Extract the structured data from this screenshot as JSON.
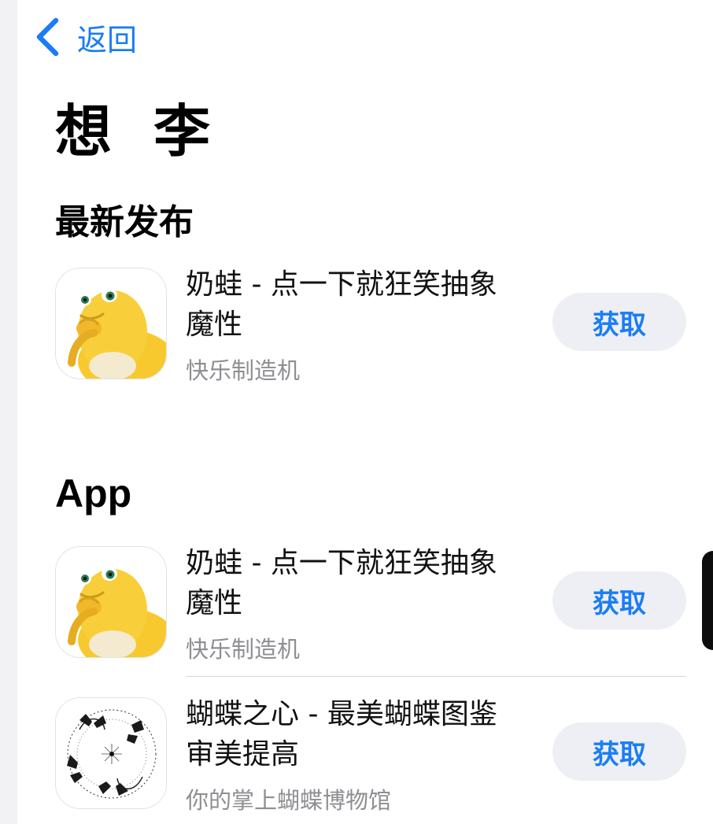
{
  "nav": {
    "back_label": "返回"
  },
  "page": {
    "title": "想 李"
  },
  "sections": [
    {
      "title": "最新发布",
      "apps": [
        {
          "name": "奶蛙 - 点一下就狂笑抽象魔性",
          "developer": "快乐制造机",
          "action": "获取",
          "icon": "yellow-frog-icon"
        }
      ]
    },
    {
      "title": "App",
      "apps": [
        {
          "name": "奶蛙 - 点一下就狂笑抽象魔性",
          "developer": "快乐制造机",
          "action": "获取",
          "icon": "yellow-frog-icon"
        },
        {
          "name": "蝴蝶之心 - 最美蝴蝶图鉴审美提高",
          "developer": "你的掌上蝴蝶博物馆",
          "action": "获取",
          "icon": "butterfly-mandala-icon"
        }
      ]
    }
  ],
  "colors": {
    "accent": "#1a7df5",
    "button_bg": "#eeeff4",
    "secondary_text": "#8e8e93"
  }
}
